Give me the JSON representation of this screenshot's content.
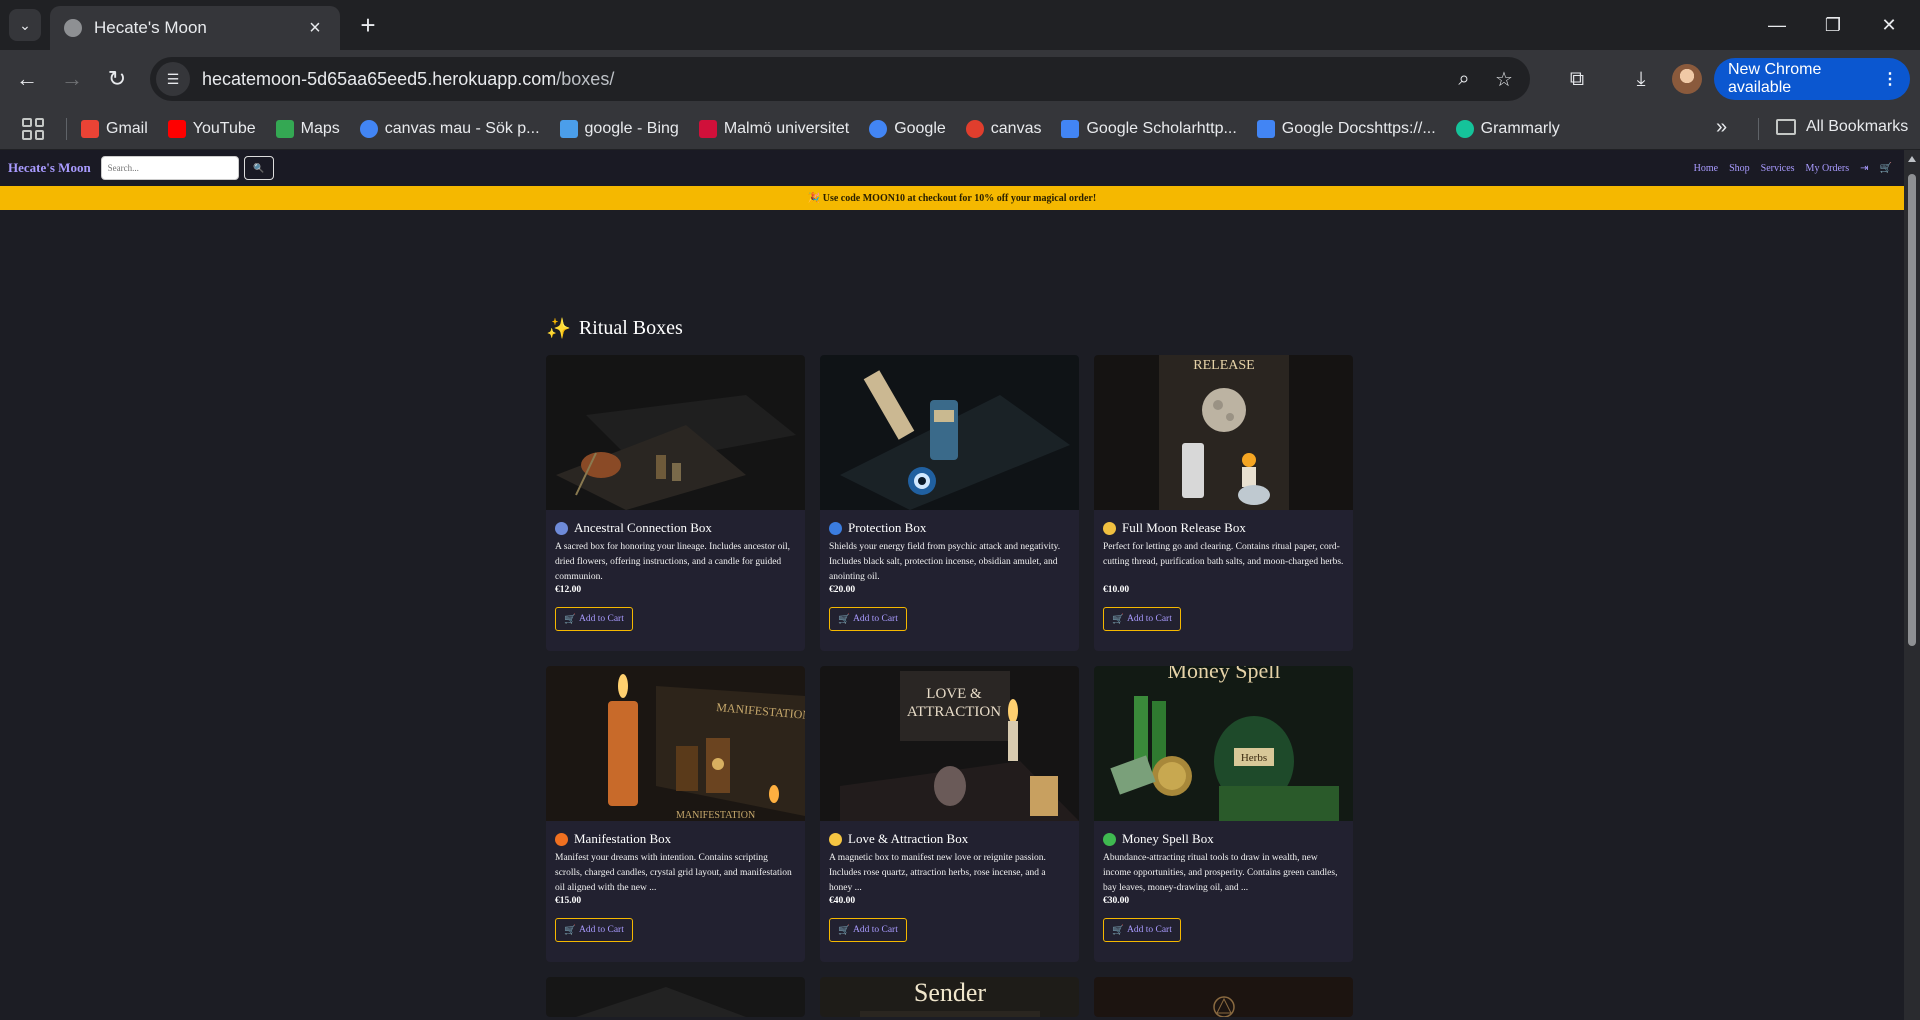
{
  "browser": {
    "tab_title": "Hecate's Moon",
    "url_host": "hecatemoon-5d65aa65eed5.herokuapp.com",
    "url_path": "/boxes/",
    "update_label": "New Chrome available",
    "bookmarks": [
      {
        "label": "Gmail",
        "icon": "gmail-icon",
        "color": "#ea4335"
      },
      {
        "label": "YouTube",
        "icon": "youtube-icon",
        "color": "#ff0000"
      },
      {
        "label": "Maps",
        "icon": "maps-icon",
        "color": "#34a853"
      },
      {
        "label": "canvas mau - Sök p...",
        "icon": "google-icon",
        "color": "#4285f4"
      },
      {
        "label": "google - Bing",
        "icon": "search-icon",
        "color": "#4b9eea"
      },
      {
        "label": "Malmö universitet",
        "icon": "malmo-icon",
        "color": "#d0103a"
      },
      {
        "label": "Google",
        "icon": "google-icon",
        "color": "#4285f4"
      },
      {
        "label": "canvas",
        "icon": "canvas-icon",
        "color": "#e03e2d"
      },
      {
        "label": "Google Scholarhttp...",
        "icon": "scholar-icon",
        "color": "#4285f4"
      },
      {
        "label": "Google Docshttps://...",
        "icon": "docs-icon",
        "color": "#4285f4"
      },
      {
        "label": "Grammarly",
        "icon": "grammarly-icon",
        "color": "#15c39a"
      }
    ],
    "all_bookmarks": "All Bookmarks"
  },
  "site": {
    "brand": "Hecate's Moon",
    "search_placeholder": "Search...",
    "nav": [
      "Home",
      "Shop",
      "Services",
      "My Orders"
    ],
    "promo": "🎉 Use code MOON10 at checkout for 10% off your magical order!",
    "section_title": "Ritual Boxes",
    "add_to_cart": "Add to Cart",
    "products": [
      {
        "title": "Ancestral Connection Box",
        "desc": "A sacred box for honoring your lineage. Includes ancestor oil, dried flowers, offering instructions, and a candle for guided communion.",
        "price": "€12.00",
        "emoji_color": "#6e8ad8"
      },
      {
        "title": "Protection Box",
        "desc": "Shields your energy field from psychic attack and negativity. Includes black salt, protection incense, obsidian amulet, and anointing oil.",
        "price": "€20.00",
        "emoji_color": "#3b7de0"
      },
      {
        "title": "Full Moon Release Box",
        "desc": "Perfect for letting go and clearing. Contains ritual paper, cord-cutting thread, purification bath salts, and moon-charged herbs.",
        "price": "€10.00",
        "emoji_color": "#f0c040"
      },
      {
        "title": "Manifestation Box",
        "desc": "Manifest your dreams with intention. Contains scripting scrolls, charged candles, crystal grid layout, and manifestation oil aligned with the new ...",
        "price": "€15.00",
        "emoji_color": "#f07020"
      },
      {
        "title": "Love & Attraction Box",
        "desc": "A magnetic box to manifest new love or reignite passion. Includes rose quartz, attraction herbs, rose incense, and a honey ...",
        "price": "€40.00",
        "emoji_color": "#f5c542"
      },
      {
        "title": "Money Spell Box",
        "desc": "Abundance-attracting ritual tools to draw in wealth, new income opportunities, and prosperity. Contains green candles, bay leaves, money-drawing oil, and ...",
        "price": "€30.00",
        "emoji_color": "#3fb950"
      }
    ],
    "image_captions": {
      "release": "RELEASE",
      "manifestation": "MANIFESTATION",
      "love": "LOVE &",
      "attraction": "ATTRACTION",
      "money": "Money Spell",
      "herbs": "Herbs",
      "sender": "Sender"
    }
  }
}
